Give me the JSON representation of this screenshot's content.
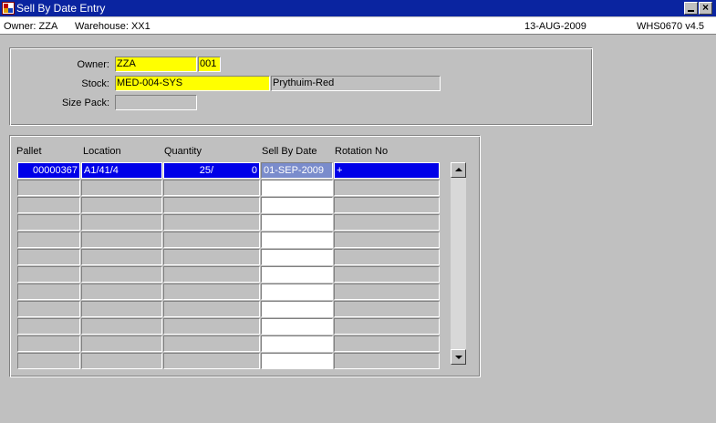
{
  "window": {
    "title": "Sell By Date Entry",
    "icon": "app-icon",
    "minimize_icon": "minimize-icon",
    "close_icon": "close-icon",
    "close_glyph": "×"
  },
  "status": {
    "owner": "Owner:  ZZA",
    "warehouse": "Warehouse:  XX1",
    "date": "13-AUG-2009",
    "module": "WHS0670  v4.5"
  },
  "header": {
    "owner_label": "Owner:",
    "owner_code": "ZZA",
    "owner_sub": "001",
    "stock_label": "Stock:",
    "stock_code": "MED-004-SYS",
    "stock_desc": "Prythuim-Red",
    "sizepack_label": "Size Pack:",
    "sizepack_value": ""
  },
  "grid": {
    "columns": [
      "Pallet",
      "Location",
      "Quantity",
      "Sell By Date",
      "Rotation No"
    ],
    "rows": [
      {
        "pallet": "00000367",
        "location": "A1/41/4",
        "qty": "25/",
        "qty2": "0",
        "sell_by": "01-SEP-2009",
        "rotation": "+"
      }
    ],
    "empty_rows": 11
  },
  "colors": {
    "title_bar": "#0a24a0",
    "background": "#c0c0c0",
    "mandatory_field": "#ffff00",
    "selected_row": "#0000e8"
  }
}
